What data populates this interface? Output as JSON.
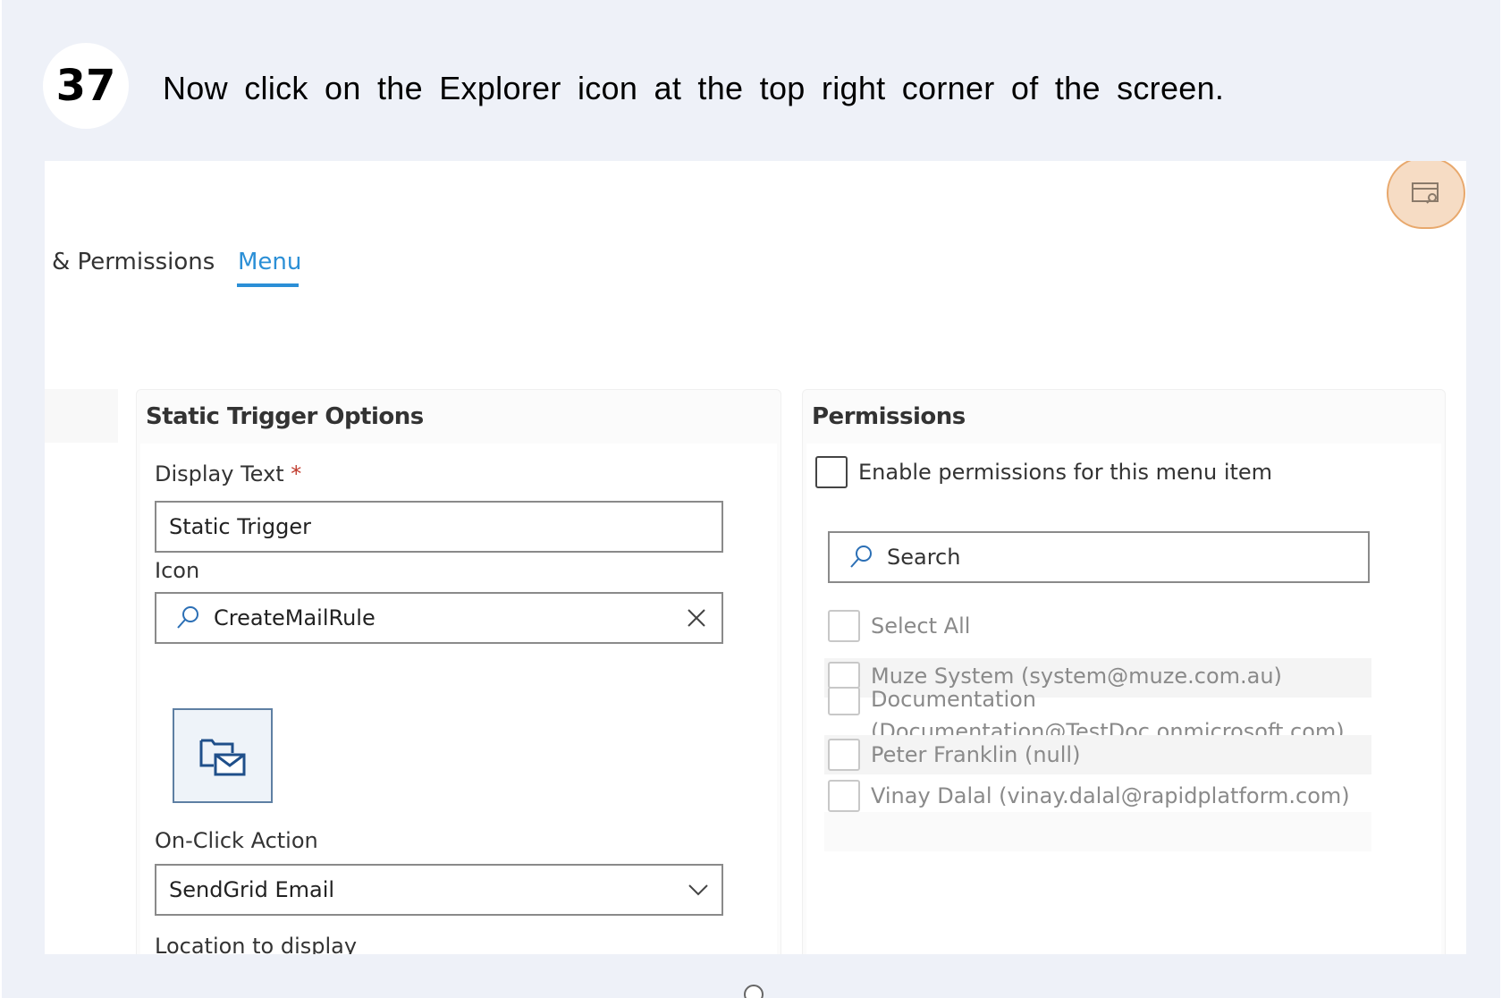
{
  "step": {
    "number": "37",
    "instruction": "Now click on the Explorer icon at the top right corner of the screen."
  },
  "tabs": [
    {
      "label": "& Permissions"
    },
    {
      "label": "Menu"
    }
  ],
  "static_panel": {
    "title": "Static Trigger Options",
    "display_text_label": "Display Text",
    "required_mark": "*",
    "display_text_value": "Static Trigger",
    "icon_label": "Icon",
    "icon_value": "CreateMailRule",
    "onclick_label": "On-Click Action",
    "onclick_value": "SendGrid Email",
    "location_label": "Location to display"
  },
  "permissions_panel": {
    "title": "Permissions",
    "enable_label": "Enable permissions for this menu item",
    "search_placeholder": "Search",
    "select_all": "Select All",
    "users": [
      "Muze System (system@muze.com.au)",
      "Documentation",
      "(Documentation@TestDoc.onmicrosoft.com)",
      "Peter Franklin (null)",
      "Vinay Dalal (vinay.dalal@rapidplatform.com)"
    ]
  },
  "colors": {
    "accent": "#2b8fd6",
    "highlight": "#e8a86c",
    "background": "#eef1f8"
  }
}
